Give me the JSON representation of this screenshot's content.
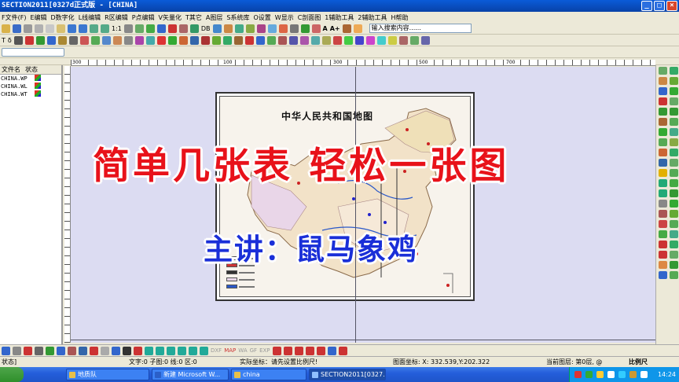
{
  "window": {
    "title": "SECTION2011[0327d正式版 - [CHINA]",
    "min": "_",
    "max": "□",
    "close": "×"
  },
  "menu": [
    "F文件(F)",
    "E编辑",
    "D数字化",
    "L线编辑",
    "R区编辑",
    "P点编辑",
    "V矢量化",
    "T其它",
    "A图层",
    "S系统库",
    "O设置",
    "W显示",
    "C剖面图",
    "1辅助工具",
    "2辅助工具",
    "H帮助"
  ],
  "toolbar": {
    "zoom_label": "1:1",
    "db_label": "DB",
    "search_value": "输入搜索内容......",
    "text_a": "A",
    "text_aplus": "A+",
    "t_label": "T",
    "delta_label": "δ"
  },
  "files": {
    "header": [
      "文件名",
      "状态"
    ],
    "rows": [
      {
        "name": "CHINA.WP"
      },
      {
        "name": "CHINA.WL"
      },
      {
        "name": "CHINA.WT"
      }
    ]
  },
  "ruler": {
    "top": [
      "300",
      "100",
      "300",
      "500",
      "700"
    ]
  },
  "map": {
    "title": "中华人民共和国地图"
  },
  "overlay": {
    "headline": "简单几张表  轻松一张图",
    "presenter": "主讲：鼠马象鸡"
  },
  "bottom": {
    "labels": [
      "DXF",
      "MAP",
      "WA",
      "GF",
      "EXP"
    ]
  },
  "status": {
    "mode": "状态]",
    "counts": "文字:0 子图:0 线:0 区:0",
    "hint": "实际坐标：请先设置比例尺!",
    "coords": "图面坐标: X: 332.539,Y:202.322",
    "layer": "当前图层: 第0层, @",
    "scale": "比例尺"
  },
  "taskbar": {
    "items": [
      "地质队",
      "新建 Microsoft W...",
      "china",
      "SECTION2011[0327..."
    ],
    "clock": "14:24"
  }
}
